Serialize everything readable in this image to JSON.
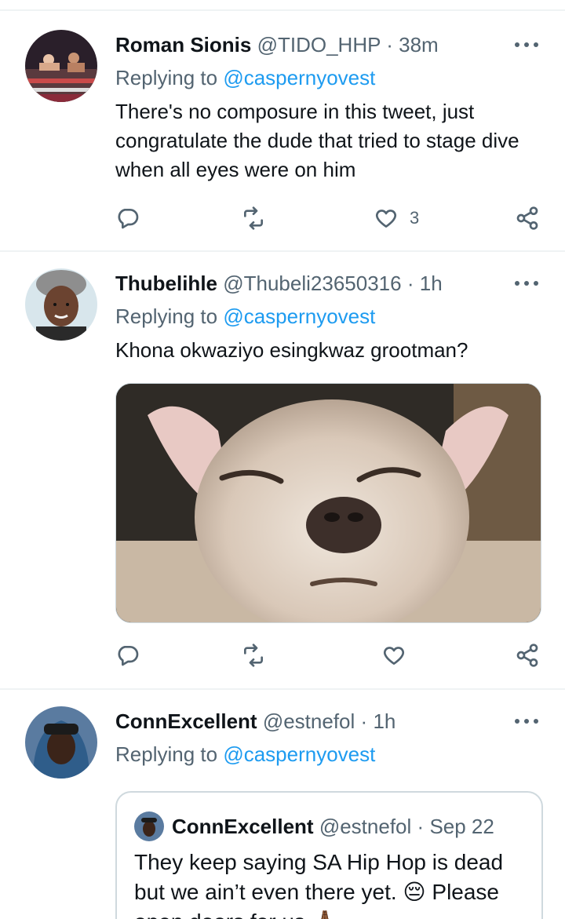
{
  "tweets": [
    {
      "name": "Roman Sionis",
      "handle": "@TIDO_HHP",
      "separator": "·",
      "time": "38m",
      "replying_prefix": "Replying to ",
      "replying_to": "@caspernyovest",
      "text": "There's no composure in this tweet, just congratulate the dude that tried to stage dive when all eyes were on him",
      "likes": "3"
    },
    {
      "name": "Thubelihle",
      "handle": "@Thubeli23650316",
      "separator": "·",
      "time": "1h",
      "replying_prefix": "Replying to ",
      "replying_to": "@caspernyovest",
      "text": "Khona okwaziyo esingkwaz grootman?",
      "likes": ""
    },
    {
      "name": "ConnExcellent",
      "handle": "@estnefol",
      "separator": "·",
      "time": "1h",
      "replying_prefix": "Replying to ",
      "replying_to": "@caspernyovest",
      "quote": {
        "name": "ConnExcellent",
        "handle": "@estnefol",
        "separator": "·",
        "time": "Sep 22",
        "text": "They keep saying SA Hip Hop is dead but we ain’t even there yet. 😔 Please open doors for us 🙏🏾"
      }
    }
  ],
  "icons": {
    "more": "more-icon",
    "reply": "reply-icon",
    "retweet": "retweet-icon",
    "like": "heart-icon",
    "share": "share-icon"
  },
  "colors": {
    "link": "#1d9bf0",
    "secondary": "#536471",
    "divider": "#eff3f4"
  }
}
